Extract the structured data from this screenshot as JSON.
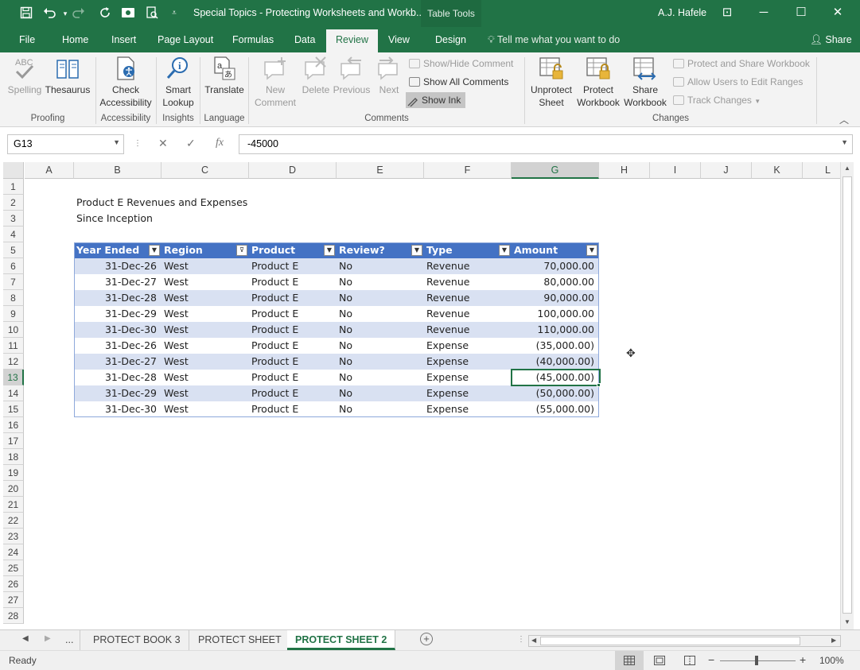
{
  "titlebar": {
    "doc_title": "Special Topics - Protecting Worksheets and Workb...",
    "context_tab": "Table Tools",
    "user": "A.J. Hafele",
    "minimize": "─",
    "restore": "☐",
    "close": "✕",
    "ribbon_display": "⊡"
  },
  "tabs": [
    "File",
    "Home",
    "Insert",
    "Page Layout",
    "Formulas",
    "Data",
    "Review",
    "View",
    "Design"
  ],
  "tell_me": "Tell me what you want to do",
  "share": "Share",
  "ribbon": {
    "proofing": {
      "label": "Proofing",
      "spelling": "Spelling",
      "thesaurus": "Thesaurus"
    },
    "accessibility": {
      "label": "Accessibility",
      "check_line1": "Check",
      "check_line2": "Accessibility"
    },
    "insights": {
      "label": "Insights",
      "smart_line1": "Smart",
      "smart_line2": "Lookup"
    },
    "language": {
      "label": "Language",
      "translate": "Translate"
    },
    "comments": {
      "label": "Comments",
      "new_line1": "New",
      "new_line2": "Comment",
      "delete": "Delete",
      "previous": "Previous",
      "next": "Next",
      "show_hide": "Show/Hide Comment",
      "show_all": "Show All Comments",
      "show_ink": "Show Ink"
    },
    "changes": {
      "label": "Changes",
      "unprotect_line1": "Unprotect",
      "unprotect_line2": "Sheet",
      "protect_wb_line1": "Protect",
      "protect_wb_line2": "Workbook",
      "share_wb_line1": "Share",
      "share_wb_line2": "Workbook",
      "protect_share": "Protect and Share Workbook",
      "allow_users": "Allow Users to Edit Ranges",
      "track_changes": "Track Changes"
    }
  },
  "formula_bar": {
    "name_box": "G13",
    "cancel": "✕",
    "enter": "✓",
    "fx": "fx",
    "formula": "-45000"
  },
  "columns": [
    "A",
    "B",
    "C",
    "D",
    "E",
    "F",
    "G",
    "H",
    "I",
    "J",
    "K",
    "L"
  ],
  "rows": [
    "1",
    "2",
    "3",
    "4",
    "5",
    "6",
    "7",
    "8",
    "9",
    "10",
    "11",
    "12",
    "13",
    "14",
    "15",
    "16",
    "17",
    "18",
    "19",
    "20",
    "21",
    "22",
    "23",
    "24",
    "25",
    "26",
    "27",
    "28"
  ],
  "sheet": {
    "title": "Product E Revenues and Expenses",
    "subtitle": "Since Inception",
    "headers": [
      "Year Ended",
      "Region",
      "Product",
      "Review?",
      "Type",
      "Amount"
    ],
    "data": [
      [
        "31-Dec-26",
        "West",
        "Product E",
        "No",
        "Revenue",
        "70,000.00"
      ],
      [
        "31-Dec-27",
        "West",
        "Product E",
        "No",
        "Revenue",
        "80,000.00"
      ],
      [
        "31-Dec-28",
        "West",
        "Product E",
        "No",
        "Revenue",
        "90,000.00"
      ],
      [
        "31-Dec-29",
        "West",
        "Product E",
        "No",
        "Revenue",
        "100,000.00"
      ],
      [
        "31-Dec-30",
        "West",
        "Product E",
        "No",
        "Revenue",
        "110,000.00"
      ],
      [
        "31-Dec-26",
        "West",
        "Product E",
        "No",
        "Expense",
        "(35,000.00)"
      ],
      [
        "31-Dec-27",
        "West",
        "Product E",
        "No",
        "Expense",
        "(40,000.00)"
      ],
      [
        "31-Dec-28",
        "West",
        "Product E",
        "No",
        "Expense",
        "(45,000.00)"
      ],
      [
        "31-Dec-29",
        "West",
        "Product E",
        "No",
        "Expense",
        "(50,000.00)"
      ],
      [
        "31-Dec-30",
        "West",
        "Product E",
        "No",
        "Expense",
        "(55,000.00)"
      ]
    ]
  },
  "sheet_tabs": {
    "ellipsis": "...",
    "tabs": [
      "PROTECT BOOK 3",
      "PROTECT SHEET",
      "PROTECT SHEET 2"
    ],
    "active": "PROTECT SHEET 2",
    "add": "+"
  },
  "status": {
    "ready": "Ready",
    "zoom": "100%",
    "minus": "−",
    "plus": "+"
  },
  "colors": {
    "excel_green": "#217346",
    "table_header": "#4472c4",
    "table_band": "#d9e1f2"
  }
}
